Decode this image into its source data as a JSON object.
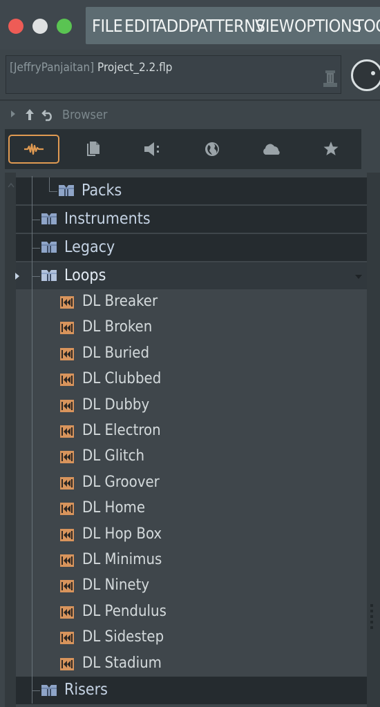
{
  "window": {
    "traffic_lights": [
      "close",
      "minimize",
      "maximize"
    ],
    "colors": {
      "close": "#ee5c56",
      "minimize": "#dfe1e2",
      "maximize": "#5ac452"
    }
  },
  "menu": {
    "items": [
      "FILE",
      "EDIT",
      "ADD",
      "PATTERNS",
      "VIEW",
      "OPTIONS",
      "TOO"
    ]
  },
  "hint": {
    "user": "[JeffryPanjaitan]",
    "file": " Project_2.2.flp"
  },
  "browser": {
    "title": "Browser",
    "toolbar": [
      {
        "name": "all-sources",
        "icon": "waveform-icon",
        "active": true
      },
      {
        "name": "current-project",
        "icon": "document-icon",
        "active": false
      },
      {
        "name": "plugin-database",
        "icon": "speaker-icon",
        "active": false
      },
      {
        "name": "online-content",
        "icon": "globe-icon",
        "active": false
      },
      {
        "name": "cloud",
        "icon": "cloud-icon",
        "active": false
      },
      {
        "name": "favorites",
        "icon": "star-icon",
        "active": false
      }
    ],
    "tree": {
      "packs_label": "Packs",
      "instruments_label": "Instruments",
      "legacy_label": "Legacy",
      "loops_label": "Loops",
      "loops": [
        "DL Breaker",
        "DL Broken",
        "DL Buried",
        "DL Clubbed",
        "DL Dubby",
        "DL Electron",
        "DL Glitch",
        "DL Groover",
        "DL Home",
        "DL Hop Box",
        "DL Minimus",
        "DL Ninety",
        "DL Pendulus",
        "DL Sidestep",
        "DL Stadium"
      ],
      "risers_label": "Risers"
    }
  },
  "colors": {
    "accent": "#e09a52",
    "folder_text": "#c4d2e3",
    "loop_icon": "#d8945c"
  }
}
